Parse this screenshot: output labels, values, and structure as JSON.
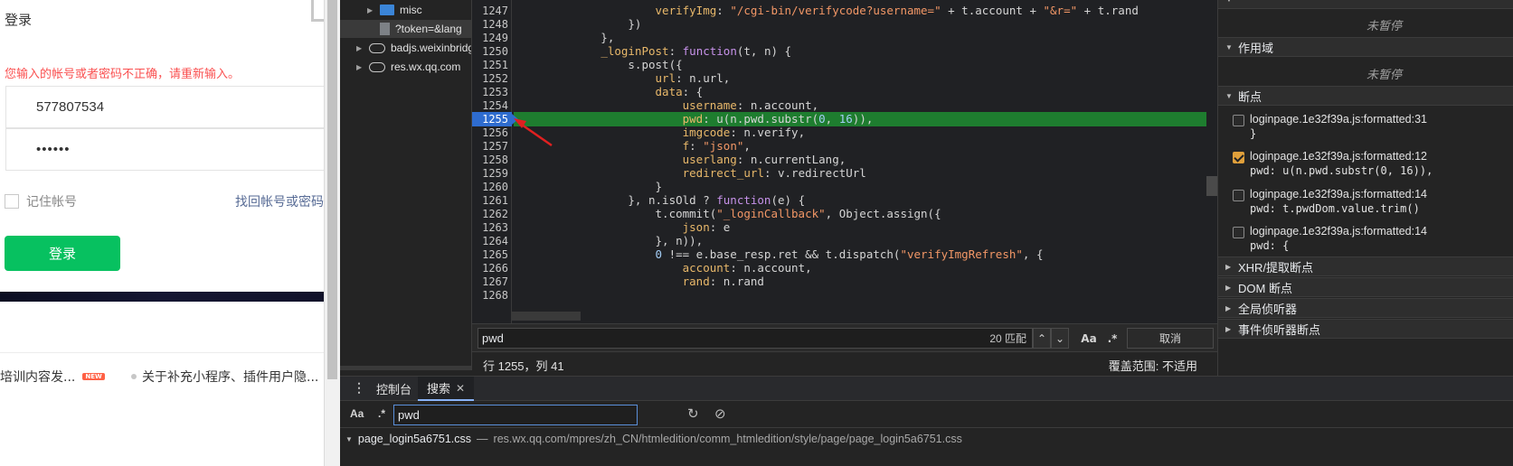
{
  "login_page": {
    "title": "登录",
    "error": "您输入的帐号或者密码不正确，请重新输入。",
    "account_value": "577807534",
    "password_value": "••••••",
    "remember_label": "记住帐号",
    "forgot_label": "找回帐号或密码",
    "login_button": "登录",
    "news_1": "培训内容发...",
    "news_1_badge": "NEW",
    "news_2": "关于补充小程序、插件用户隐..."
  },
  "nav_tree": {
    "items": [
      {
        "label": "misc",
        "icon": "folder-icon"
      },
      {
        "label": "?token=&lang",
        "icon": "file-icon"
      },
      {
        "label": "badjs.weixinbridge",
        "icon": "cloud-icon"
      },
      {
        "label": "res.wx.qq.com",
        "icon": "cloud-icon"
      }
    ]
  },
  "editor": {
    "lines": [
      {
        "n": "1247",
        "code": "                    verifyImg: \"/cgi-bin/verifycode?username=\" + t.account + \"&r=\" + t.rand"
      },
      {
        "n": "1248",
        "code": "                })"
      },
      {
        "n": "1249",
        "code": "            },"
      },
      {
        "n": "1250",
        "code": "            _loginPost: function(t, n) {"
      },
      {
        "n": "1251",
        "code": "                s.post({"
      },
      {
        "n": "1252",
        "code": "                    url: n.url,"
      },
      {
        "n": "1253",
        "code": "                    data: {"
      },
      {
        "n": "1254",
        "code": "                        username: n.account,"
      },
      {
        "n": "1255",
        "code": "                        pwd: u(n.pwd.substr(0, 16)),"
      },
      {
        "n": "1256",
        "code": "                        imgcode: n.verify,"
      },
      {
        "n": "1257",
        "code": "                        f: \"json\","
      },
      {
        "n": "1258",
        "code": "                        userlang: n.currentLang,"
      },
      {
        "n": "1259",
        "code": "                        redirect_url: v.redirectUrl"
      },
      {
        "n": "1260",
        "code": "                    }"
      },
      {
        "n": "1261",
        "code": "                }, n.isOld ? function(e) {"
      },
      {
        "n": "1262",
        "code": "                    t.commit(\"_loginCallback\", Object.assign({"
      },
      {
        "n": "1263",
        "code": "                        json: e"
      },
      {
        "n": "1264",
        "code": "                    }, n)),"
      },
      {
        "n": "1265",
        "code": "                    0 !== e.base_resp.ret && t.dispatch(\"verifyImgRefresh\", {"
      },
      {
        "n": "1266",
        "code": "                        account: n.account,"
      },
      {
        "n": "1267",
        "code": "                        rand: n.rand"
      },
      {
        "n": "1268",
        "code": ""
      }
    ],
    "highlight_line": "1255"
  },
  "find_bar": {
    "query": "pwd",
    "count": "20 匹配",
    "case_label": "Aa",
    "regex_label": ".*",
    "cancel_label": "取消"
  },
  "editor_status": {
    "position": "行 1255，列 41",
    "coverage": "覆盖范围: 不适用"
  },
  "debug_pane": {
    "not_paused_1": "未暂停",
    "scope_label": "作用域",
    "not_paused_2": "未暂停",
    "breakpoints_label": "断点",
    "breakpoints": [
      {
        "file": "loginpage.1e32f39a.js:formatted:31",
        "code": "}",
        "checked": false
      },
      {
        "file": "loginpage.1e32f39a.js:formatted:12",
        "code": "pwd: u(n.pwd.substr(0, 16)),",
        "checked": true
      },
      {
        "file": "loginpage.1e32f39a.js:formatted:14",
        "code": "pwd: t.pwdDom.value.trim()",
        "checked": false
      },
      {
        "file": "loginpage.1e32f39a.js:formatted:14",
        "code": "pwd: {",
        "checked": false
      }
    ],
    "xhr_label": "XHR/提取断点",
    "dom_label": "DOM 断点",
    "global_label": "全局侦听器",
    "event_label": "事件侦听器断点"
  },
  "drawer": {
    "console_tab": "控制台",
    "search_tab": "搜索",
    "search_query": "pwd",
    "case_label": "Aa",
    "regex_label": ".*",
    "result_file": "page_login5a6751.css",
    "result_sep": "—",
    "result_path": "res.wx.qq.com/mpres/zh_CN/htmledition/comm_htmledition/style/page/page_login5a6751.css"
  },
  "colors": {
    "login_green": "#07c160",
    "error_red": "#fa5151",
    "breakpoint_blue": "#2e6ccf",
    "exec_line_green": "#1e7d2f",
    "annotation_red": "#e02020"
  }
}
